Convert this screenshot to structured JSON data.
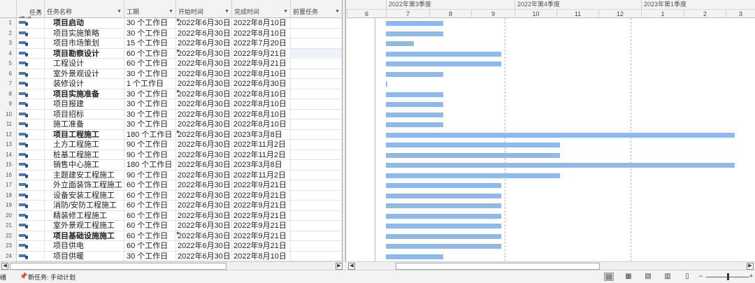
{
  "columns": {
    "id": "",
    "mode": "任务\n模式",
    "name": "任务名称",
    "duration": "工期",
    "start": "开始时间",
    "finish": "完成时间",
    "predecessors": "前置任务"
  },
  "tasks": [
    {
      "id": "1",
      "name": "项目启动",
      "summary": true,
      "duration": "30 个工作日",
      "start": "2022年6月30日",
      "finish": "2022年8月10日"
    },
    {
      "id": "2",
      "name": "项目实施策略",
      "summary": false,
      "duration": "30 个工作日",
      "start": "2022年6月30日",
      "finish": "2022年8月10日"
    },
    {
      "id": "3",
      "name": "项目市场策划",
      "summary": false,
      "duration": "15 个工作日",
      "start": "2022年6月30日",
      "finish": "2022年7月20日"
    },
    {
      "id": "4",
      "name": "项目勘察设计",
      "summary": true,
      "duration": "60 个工作日",
      "start": "2022年6月30日",
      "finish": "2022年9月21日"
    },
    {
      "id": "5",
      "name": "工程设计",
      "summary": false,
      "duration": "60 个工作日",
      "start": "2022年6月30日",
      "finish": "2022年9月21日"
    },
    {
      "id": "6",
      "name": "室外景观设计",
      "summary": false,
      "duration": "30 个工作日",
      "start": "2022年6月30日",
      "finish": "2022年8月10日"
    },
    {
      "id": "7",
      "name": "装修设计",
      "summary": false,
      "duration": "1 个工作日",
      "start": "2022年6月30日",
      "finish": "2022年6月30日"
    },
    {
      "id": "8",
      "name": "项目实施准备",
      "summary": true,
      "duration": "30 个工作日",
      "start": "2022年6月30日",
      "finish": "2022年8月10日"
    },
    {
      "id": "9",
      "name": "项目报建",
      "summary": false,
      "duration": "30 个工作日",
      "start": "2022年6月30日",
      "finish": "2022年8月10日"
    },
    {
      "id": "10",
      "name": "项目招标",
      "summary": false,
      "duration": "30 个工作日",
      "start": "2022年6月30日",
      "finish": "2022年8月10日"
    },
    {
      "id": "11",
      "name": "施工准备",
      "summary": false,
      "duration": "30 个工作日",
      "start": "2022年6月30日",
      "finish": "2022年8月10日"
    },
    {
      "id": "12",
      "name": "项目工程施工",
      "summary": true,
      "duration": "180 个工作日",
      "start": "2022年6月30日",
      "finish": "2023年3月8日"
    },
    {
      "id": "13",
      "name": "土方工程施工",
      "summary": false,
      "duration": "90 个工作日",
      "start": "2022年6月30日",
      "finish": "2022年11月2日"
    },
    {
      "id": "14",
      "name": "桩基工程施工",
      "summary": false,
      "duration": "90 个工作日",
      "start": "2022年6月30日",
      "finish": "2022年11月2日"
    },
    {
      "id": "15",
      "name": "销售中心施工",
      "summary": false,
      "duration": "180 个工作日",
      "start": "2022年6月30日",
      "finish": "2023年3月8日"
    },
    {
      "id": "16",
      "name": "主题建安工程施工",
      "summary": false,
      "duration": "90 个工作日",
      "start": "2022年6月30日",
      "finish": "2022年11月2日"
    },
    {
      "id": "17",
      "name": "外立面装饰工程施工",
      "summary": false,
      "duration": "60 个工作日",
      "start": "2022年6月30日",
      "finish": "2022年9月21日"
    },
    {
      "id": "18",
      "name": "设备安装工程施工",
      "summary": false,
      "duration": "60 个工作日",
      "start": "2022年6月30日",
      "finish": "2022年9月21日"
    },
    {
      "id": "19",
      "name": "消防/安防工程施工",
      "summary": false,
      "duration": "60 个工作日",
      "start": "2022年6月30日",
      "finish": "2022年9月21日"
    },
    {
      "id": "20",
      "name": "精装修工程施工",
      "summary": false,
      "duration": "60 个工作日",
      "start": "2022年6月30日",
      "finish": "2022年9月21日"
    },
    {
      "id": "21",
      "name": "室外景观工程施工",
      "summary": false,
      "duration": "60 个工作日",
      "start": "2022年6月30日",
      "finish": "2022年9月21日"
    },
    {
      "id": "22",
      "name": "项目基础设施施工",
      "summary": true,
      "duration": "60 个工作日",
      "start": "2022年6月30日",
      "finish": "2022年9月21日"
    },
    {
      "id": "23",
      "name": "项目供电",
      "summary": false,
      "duration": "60 个工作日",
      "start": "2022年6月30日",
      "finish": "2022年9月21日"
    },
    {
      "id": "24",
      "name": "项目供暖",
      "summary": false,
      "duration": "30 个工作日",
      "start": "2022年6月30日",
      "finish": "2022年8月10日"
    }
  ],
  "timescale": {
    "quarters": [
      "2022年第3季度",
      "2022年第4季度",
      "2023年第1季度"
    ],
    "months": [
      "6",
      "7",
      "8",
      "9",
      "10",
      "11",
      "12",
      "1",
      "2",
      "3"
    ]
  },
  "gantt": {
    "bar_color": "#8fb9e8",
    "bars": [
      {
        "start": "2022-06-30",
        "finish": "2022-08-10"
      },
      {
        "start": "2022-06-30",
        "finish": "2022-08-10"
      },
      {
        "start": "2022-06-30",
        "finish": "2022-07-20"
      },
      {
        "start": "2022-06-30",
        "finish": "2022-09-21"
      },
      {
        "start": "2022-06-30",
        "finish": "2022-09-21"
      },
      {
        "start": "2022-06-30",
        "finish": "2022-08-10"
      },
      {
        "start": "2022-06-30",
        "finish": "2022-06-30"
      },
      {
        "start": "2022-06-30",
        "finish": "2022-08-10"
      },
      {
        "start": "2022-06-30",
        "finish": "2022-08-10"
      },
      {
        "start": "2022-06-30",
        "finish": "2022-08-10"
      },
      {
        "start": "2022-06-30",
        "finish": "2022-08-10"
      },
      {
        "start": "2022-06-30",
        "finish": "2023-03-08"
      },
      {
        "start": "2022-06-30",
        "finish": "2022-11-02"
      },
      {
        "start": "2022-06-30",
        "finish": "2022-11-02"
      },
      {
        "start": "2022-06-30",
        "finish": "2023-03-08"
      },
      {
        "start": "2022-06-30",
        "finish": "2022-11-02"
      },
      {
        "start": "2022-06-30",
        "finish": "2022-09-21"
      },
      {
        "start": "2022-06-30",
        "finish": "2022-09-21"
      },
      {
        "start": "2022-06-30",
        "finish": "2022-09-21"
      },
      {
        "start": "2022-06-30",
        "finish": "2022-09-21"
      },
      {
        "start": "2022-06-30",
        "finish": "2022-09-21"
      },
      {
        "start": "2022-06-30",
        "finish": "2022-09-21"
      },
      {
        "start": "2022-06-30",
        "finish": "2022-09-21"
      },
      {
        "start": "2022-06-30",
        "finish": "2022-08-10"
      }
    ]
  },
  "statusbar": {
    "ready": "绪",
    "new_tasks": "新任务: 手动计划",
    "pin_icon": "pushpin-icon"
  }
}
